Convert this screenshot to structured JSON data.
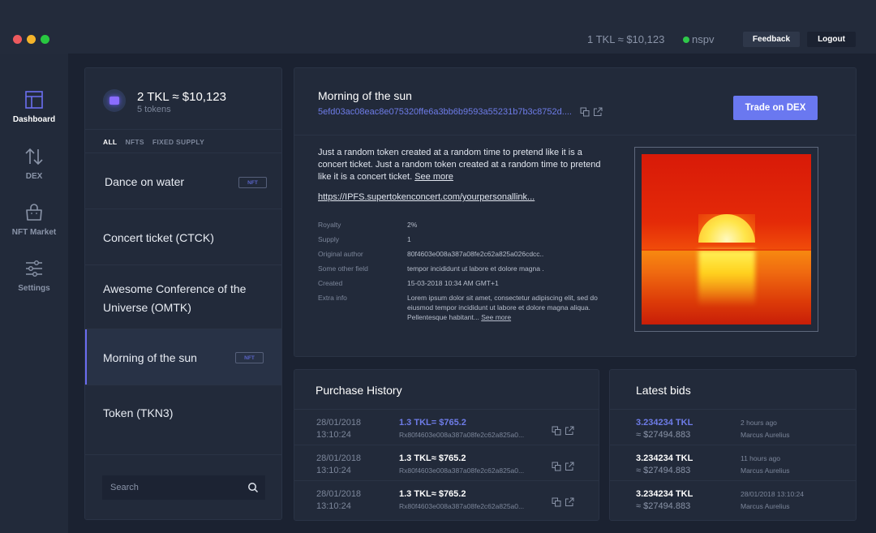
{
  "window": {
    "controls": [
      "close",
      "minimize",
      "maximize"
    ]
  },
  "topbar": {
    "rate": "1 TKL  ≈ $10,123",
    "user": "nspv",
    "user_status_color": "#2fc84a",
    "feedback_label": "Feedback",
    "logout_label": "Logout"
  },
  "nav": {
    "items": [
      {
        "label": "Dashboard",
        "icon": "layout-icon",
        "active": true
      },
      {
        "label": "DEX",
        "icon": "swap-arrows-icon",
        "active": false
      },
      {
        "label": "NFT Market",
        "icon": "shopping-bag-icon",
        "active": false
      },
      {
        "label": "Settings",
        "icon": "sliders-icon",
        "active": false
      }
    ]
  },
  "tokens": {
    "balance": "2 TKL ≈ $10,123",
    "count": "5 tokens",
    "filters": [
      {
        "label": "ALL",
        "active": true
      },
      {
        "label": "NFTS",
        "active": false
      },
      {
        "label": "FIXED SUPPLY",
        "active": false
      }
    ],
    "items": [
      {
        "name": "Dance on water",
        "badge": "NFT",
        "selected": false
      },
      {
        "name": "Concert ticket (CTCK)",
        "badge": null,
        "selected": false
      },
      {
        "name": "Awesome Conference of the Universe (OMTK)",
        "badge": null,
        "selected": false
      },
      {
        "name": "Morning of the sun",
        "badge": "NFT",
        "selected": true
      },
      {
        "name": "Token (TKN3)",
        "badge": null,
        "selected": false
      }
    ],
    "search_placeholder": "Search"
  },
  "detail": {
    "title": "Morning of the sun",
    "hash": "5efd03ac08eac8e075320ffe6a3bb6b9593a55231b7b3c8752d....",
    "trade_label": "Trade on DEX",
    "accent_color": "#6a78f0",
    "description": "Just a random token created at a random time to pretend like it is  a concert ticket. Just a random token created at a random time to pretend like it is  a concert ticket.",
    "see_more": "See more",
    "link": "https://IPFS.supertokenconcert.com/yourpersonallink...",
    "properties": [
      {
        "key": "Royalty",
        "value": "2%"
      },
      {
        "key": "Supply",
        "value": "1"
      },
      {
        "key": "Original author",
        "value": "80f4603e008a387a08fe2c62a825a026cdcc.."
      },
      {
        "key": "Some other field",
        "value": "tempor incididunt ut labore et dolore magna ."
      },
      {
        "key": "Created",
        "value": "15-03-2018 10:34 AM GMT+1"
      },
      {
        "key": "Extra info",
        "value": "Lorem ipsum dolor sit amet, consectetur adipiscing elit, sed do eiusmod tempor incididunt ut labore et dolore magna aliqua. Pellentesque habitant...",
        "more": "See more"
      }
    ],
    "image_alt": "Sunset over the sea"
  },
  "history": {
    "title": "Purchase History",
    "rows": [
      {
        "date": "28/01/2018",
        "time": "13:10:24",
        "amount": "1.3 TKL= $765.2",
        "hash": "Rx80f4603e008a387a08fe2c62a825a0...",
        "highlight": true
      },
      {
        "date": "28/01/2018",
        "time": "13:10:24",
        "amount": "1.3 TKL≈ $765.2",
        "hash": "Rx80f4603e008a387a08fe2c62a825a0...",
        "highlight": false
      },
      {
        "date": "28/01/2018",
        "time": "13:10:24",
        "amount": "1.3 TKL≈ $765.2",
        "hash": "Rx80f4603e008a387a08fe2c62a825a0...",
        "highlight": false
      }
    ]
  },
  "bids": {
    "title": "Latest bids",
    "rows": [
      {
        "amount": "3.234234 TKL",
        "usd": "≈ $27494.883",
        "time": "2 hours ago",
        "user": "Marcus Aurelius",
        "highlight": true
      },
      {
        "amount": "3.234234 TKL",
        "usd": "≈ $27494.883",
        "time": "11 hours ago",
        "user": "Marcus Aurelius",
        "highlight": false
      },
      {
        "amount": "3.234234 TKL",
        "usd": "≈ $27494.883",
        "time": "28/01/2018 13:10:24",
        "user": "Marcus Aurelius",
        "highlight": false
      }
    ]
  }
}
